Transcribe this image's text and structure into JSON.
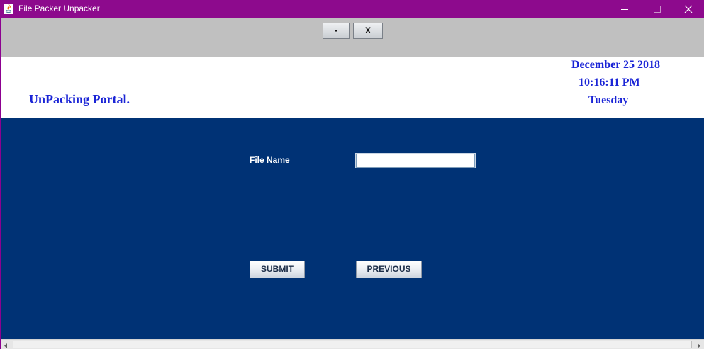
{
  "window": {
    "title": "File Packer Unpacker",
    "colors": {
      "titlebar": "#8d0a8d",
      "toolbar": "#c0c0c0",
      "header": "#ffffff",
      "panel": "#003275",
      "accent_text": "#1a24d6"
    },
    "controls": {
      "minimize_icon": "minimize-icon",
      "maximize_icon": "maximize-icon",
      "close_icon": "close-icon"
    }
  },
  "toolbar": {
    "minimize_label": "-",
    "close_label": "X"
  },
  "header": {
    "portal_title": "UnPacking Portal.",
    "date": "December 25 2018",
    "time": "10:16:11 PM",
    "day": "Tuesday"
  },
  "form": {
    "file_name_label": "File Name",
    "file_name_value": "",
    "submit_label": "SUBMIT",
    "previous_label": "PREVIOUS"
  },
  "scrollbar": {
    "left_icon": "arrow-left-icon",
    "right_icon": "arrow-right-icon"
  }
}
